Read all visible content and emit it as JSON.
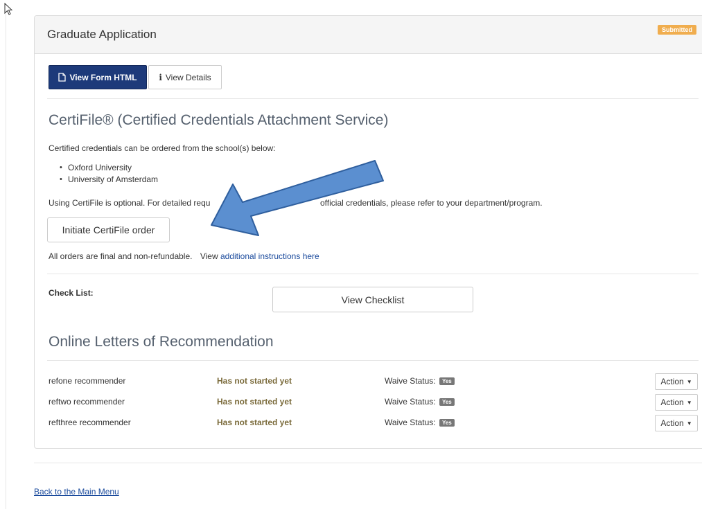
{
  "panel": {
    "title": "Graduate Application",
    "badge": "Submitted",
    "buttons": {
      "view_form": "View Form HTML",
      "view_details": "View Details"
    }
  },
  "certifile": {
    "heading": "CertiFile® (Certified Credentials Attachment Service)",
    "intro": "Certified credentials can be ordered from the school(s) below:",
    "schools": [
      "Oxford University",
      "University of Amsterdam"
    ],
    "optional_text_start": "Using CertiFile is optional. For detailed requ",
    "optional_text_end": "official credentials, please refer to your department/program.",
    "order_button": "Initiate CertiFile order",
    "final_text": "All orders are final and non-refundable.",
    "view_prefix": "View",
    "instructions_link": "additional instructions here"
  },
  "checklist": {
    "label": "Check List:",
    "button": "View Checklist"
  },
  "recommendations": {
    "heading": "Online Letters of Recommendation",
    "waive_label": "Waive Status:",
    "rows": [
      {
        "name": "refone recommender",
        "status": "Has not started yet",
        "waive": "Yes",
        "action": "Action"
      },
      {
        "name": "reftwo recommender",
        "status": "Has not started yet",
        "waive": "Yes",
        "action": "Action"
      },
      {
        "name": "refthree recommender",
        "status": "Has not started yet",
        "waive": "Yes",
        "action": "Action"
      }
    ]
  },
  "footer": {
    "back_link": "Back to the Main Menu"
  },
  "colors": {
    "primary_button": "#1d3a7a",
    "submitted_badge": "#f0ad4e",
    "status_text": "#7a6a3a",
    "link": "#1a4a9c",
    "annotation_arrow": "#5b8fd0"
  }
}
